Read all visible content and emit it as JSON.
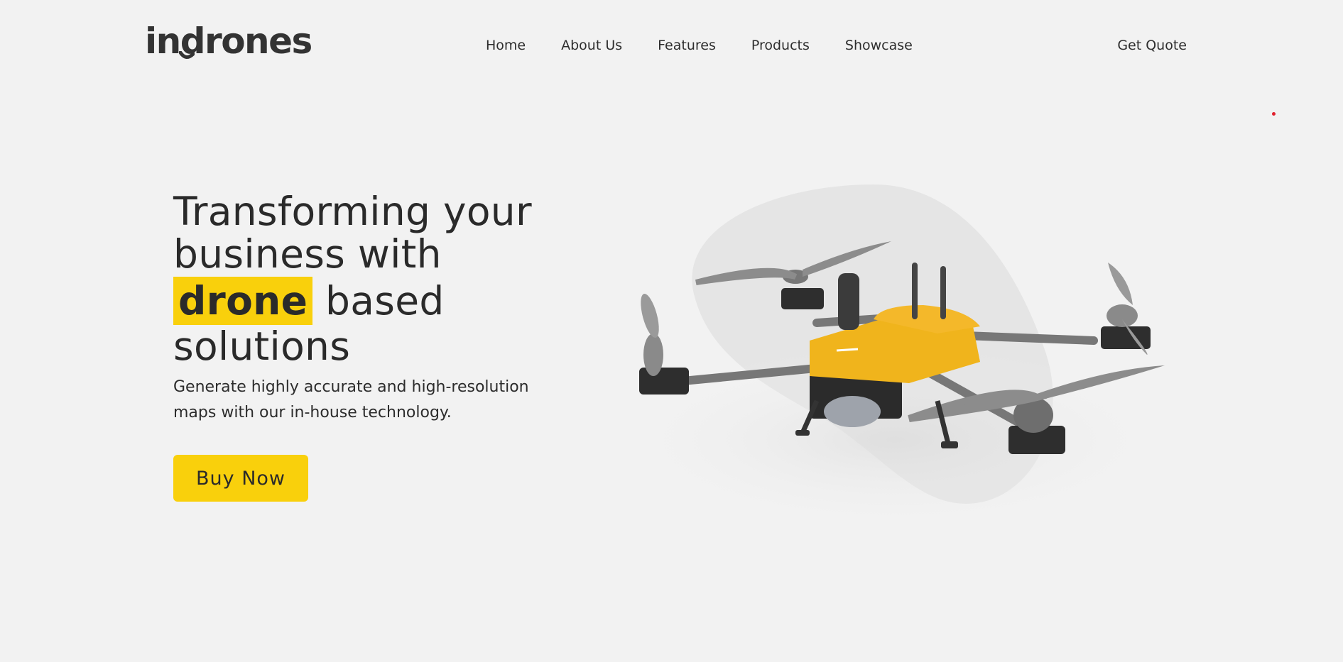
{
  "header": {
    "logo_pre": "in",
    "logo_hook": "d",
    "logo_post": "rones",
    "nav": [
      "Home",
      "About Us",
      "Features",
      "Products",
      "Showcase"
    ],
    "cta": "Get Quote"
  },
  "hero": {
    "headline_line1": "Transforming your",
    "headline_line2": "business with",
    "headline_highlight": "drone",
    "headline_line3_rest": " based",
    "headline_line4": "solutions",
    "subtext": "Generate highly accurate and high-resolution maps with our in-house technology.",
    "button": "Buy Now"
  },
  "colors": {
    "accent": "#f9d00c",
    "background": "#f2f2f2",
    "text": "#2b2b2b"
  },
  "icons": {
    "hero_image": "drone-illustration",
    "dot": "red-dot"
  }
}
